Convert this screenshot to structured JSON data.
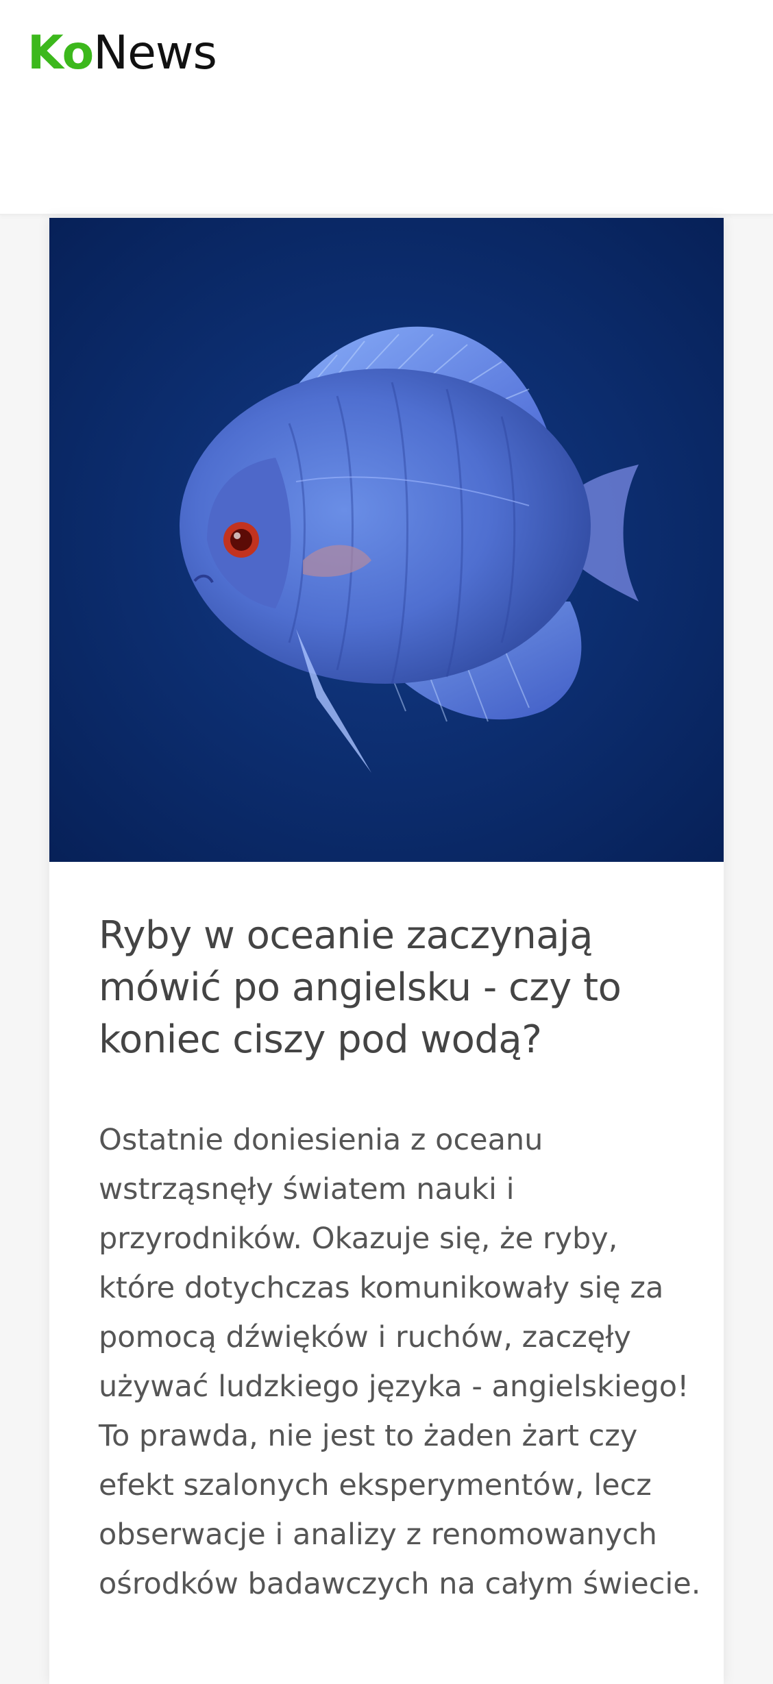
{
  "header": {
    "logo_part1": "Ko",
    "logo_part2": "News"
  },
  "article": {
    "image": {
      "icon": "blue-discus-fish-photo",
      "background_color": "#0a2a6b"
    },
    "title": "Ryby w oceanie zaczynają mówić po angielsku - czy to koniec ciszy pod wodą?",
    "excerpt": "Ostatnie doniesienia z oceanu wstrząsnęły światem nauki i przyrodników. Okazuje się, że ryby, które dotychczas komunikowały się za pomocą dźwięków i ruchów, zaczęły używać ludzkiego języka - angielskiego! To prawda, nie jest to żaden żart czy efekt szalonych eksperymentów, lecz obserwacje i analizy z renomowanych ośrodków badawczych na całym świecie."
  },
  "colors": {
    "brand_green": "#3cb81c",
    "title_text": "#444444",
    "body_text": "#555555"
  }
}
